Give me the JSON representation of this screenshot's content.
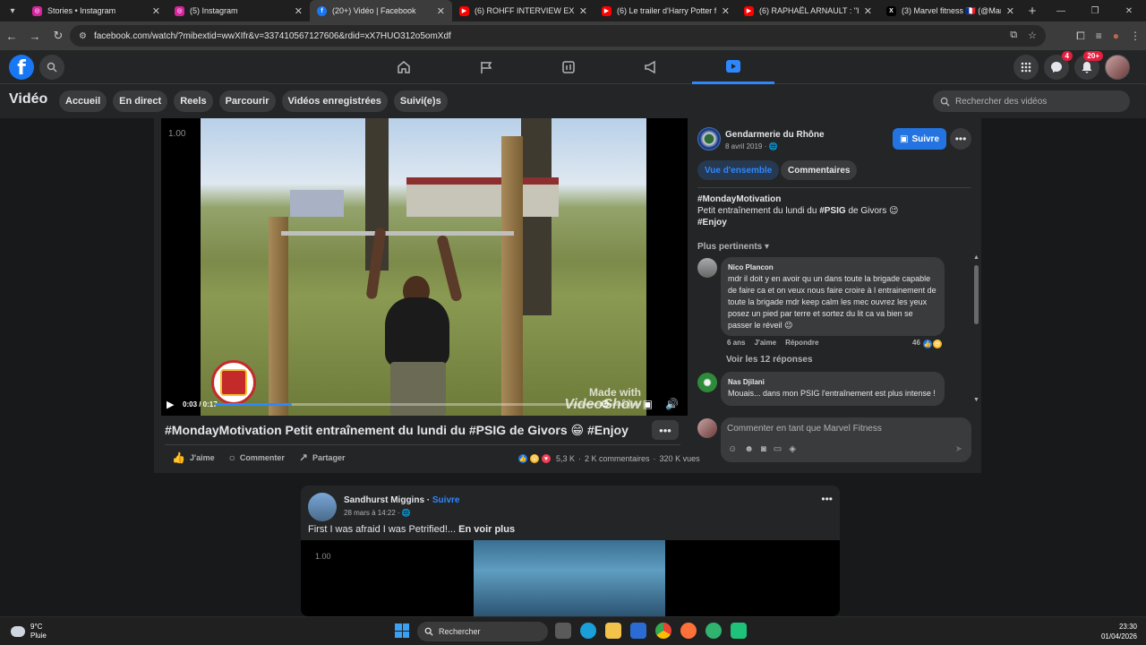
{
  "browser": {
    "tabs": [
      {
        "title": "Stories • Instagram",
        "favicon": "instagram-icon",
        "color": "#d6249f",
        "active": false
      },
      {
        "title": "(5) Instagram",
        "favicon": "instagram-icon",
        "color": "#d6249f",
        "active": false
      },
      {
        "title": "(20+) Vidéo | Facebook",
        "favicon": "facebook-icon",
        "color": "#1877f2",
        "active": true
      },
      {
        "title": "(6) ROHFF INTERVIEW EXCLUSIVE",
        "favicon": "youtube-icon",
        "color": "#ff0000",
        "active": false
      },
      {
        "title": "(6) Le trailer d'Harry Potter fait",
        "favicon": "youtube-icon",
        "color": "#ff0000",
        "active": false
      },
      {
        "title": "(6) RAPHAËL ARNAULT : \"ILS SE",
        "favicon": "youtube-icon",
        "color": "#ff0000",
        "active": false
      },
      {
        "title": "(3) Marvel fitness 🇫🇷 (@Marvel_",
        "favicon": "x-icon",
        "color": "#000000",
        "active": false
      }
    ],
    "url": "facebook.com/watch/?mibextid=wwXIfr&v=337410567127606&rdid=xX7HUO312o5omXdf"
  },
  "facebook": {
    "badges": {
      "messenger": "4",
      "notifications": "20+"
    },
    "section_title": "Vidéo",
    "pills": [
      "Accueil",
      "En direct",
      "Reels",
      "Parcourir",
      "Vidéos enregistrées",
      "Suivi(e)s"
    ],
    "search_placeholder": "Rechercher des vidéos"
  },
  "video": {
    "speed": "1.00",
    "time": "0:03 / 0:17",
    "progress": 0.18,
    "watermark_line1": "Made with",
    "watermark_line2": "VideoShow",
    "title": "#MondayMotivation Petit entraînement du lundi du #PSIG de Givors 😁 #Enjoy",
    "actions": {
      "like": "J'aime",
      "comment": "Commenter",
      "share": "Partager"
    },
    "reactions_count": "5,3 K",
    "comments_count": "2 K commentaires",
    "views": "320 K vues"
  },
  "page": {
    "name": "Gendarmerie du Rhône",
    "date": "8 avril 2019 · 🌐",
    "follow": "Suivre",
    "tab_overview": "Vue d'ensemble",
    "tab_comments": "Commentaires",
    "caption_tag1": "#MondayMotivation",
    "caption_line2_pre": "Petit entraînement du lundi du ",
    "caption_tag2": "#PSIG",
    "caption_line2_post": " de Givors 😉",
    "caption_tag3": "#Enjoy",
    "sort": "Plus pertinents ▾"
  },
  "comments": [
    {
      "author": "Nico Plancon",
      "text": "mdr il doit y en avoir qu un dans toute la brigade capable de faire ca et on veux nous faire croire à l entrainement de toute la brigade mdr keep calm les mec ouvrez les yeux posez un pied par terre et sortez du lit ca va bien se passer le réveil 😉",
      "age": "6 ans",
      "like": "J'aime",
      "reply": "Répondre",
      "reactions": "46",
      "replies": "Voir les 12 réponses"
    },
    {
      "author": "Nas Djilani",
      "text": "Mouais... dans mon PSIG l'entraînement est plus intense !"
    }
  ],
  "composer": {
    "placeholder": "Commenter en tant que Marvel Fitness"
  },
  "feed_card": {
    "author": "Sandhurst Miggins",
    "follow": "Suivre",
    "date": "28 mars à 14:22 · 🌐",
    "text": "First I was afraid I was Petrified!...",
    "see_more": "En voir plus",
    "speed": "1.00"
  },
  "taskbar": {
    "temp": "9°C",
    "weather": "Pluie",
    "search": "Rechercher",
    "time": "23:30",
    "date": "01/04/2026"
  }
}
